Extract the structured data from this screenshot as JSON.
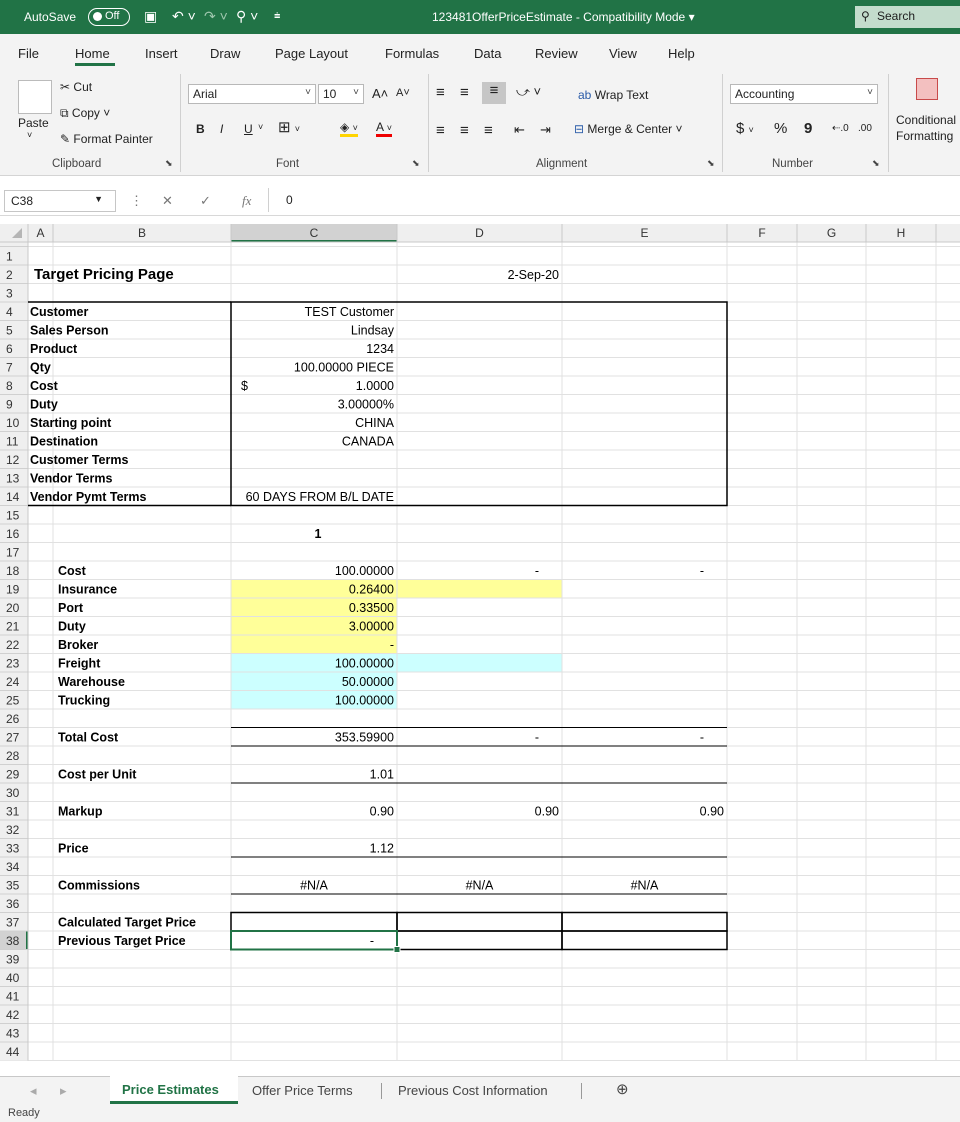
{
  "titlebar": {
    "autosave_label": "AutoSave",
    "autosave_state": "Off",
    "doc_title": "123481OfferPriceEstimate  -  Compatibility Mode",
    "search_label": "Search"
  },
  "menu": [
    "File",
    "Home",
    "Insert",
    "Draw",
    "Page Layout",
    "Formulas",
    "Data",
    "Review",
    "View",
    "Help"
  ],
  "ribbon": {
    "paste": "Paste",
    "cut": "Cut",
    "copy": "Copy",
    "format_painter": "Format Painter",
    "clipboard_group": "Clipboard",
    "font_name": "Arial",
    "font_size": "10",
    "bold": "B",
    "italic": "I",
    "underline": "U",
    "font_group": "Font",
    "wrap_text": "Wrap Text",
    "merge_center": "Merge & Center",
    "alignment_group": "Alignment",
    "number_format": "Accounting",
    "currency": "$",
    "percent": "%",
    "comma": "9",
    "number_group": "Number",
    "conditional_formatting": "Conditional Formatting"
  },
  "formula_bar": {
    "name_box": "C38",
    "fx": "fx",
    "value": "0"
  },
  "columns": [
    "A",
    "B",
    "C",
    "D",
    "E",
    "F",
    "G",
    "H"
  ],
  "rows": [
    "1",
    "2",
    "3",
    "4",
    "5",
    "6",
    "7",
    "8",
    "9",
    "10",
    "11",
    "12",
    "13",
    "14",
    "15",
    "16",
    "17",
    "18",
    "19",
    "20",
    "21",
    "22",
    "23",
    "24",
    "25",
    "26",
    "27",
    "28",
    "29",
    "30",
    "31",
    "32",
    "33",
    "34",
    "35",
    "36",
    "37",
    "38",
    "39",
    "40",
    "41",
    "42",
    "43",
    "44"
  ],
  "cells": {
    "title": "Target Pricing Page",
    "date": "2-Sep-20",
    "info": [
      {
        "label": "Customer",
        "value": "TEST Customer"
      },
      {
        "label": "Sales Person",
        "value": "Lindsay"
      },
      {
        "label": "Product",
        "value": "1234"
      },
      {
        "label": "Qty",
        "value": "100.00000 PIECE"
      },
      {
        "label": "Cost",
        "value": "1.0000",
        "prefix": "$"
      },
      {
        "label": "Duty",
        "value": "3.00000%"
      },
      {
        "label": "Starting point",
        "value": "CHINA"
      },
      {
        "label": "Destination",
        "value": "CANADA"
      },
      {
        "label": "Customer Terms",
        "value": ""
      },
      {
        "label": "Vendor Terms",
        "value": ""
      },
      {
        "label": "Vendor Pymt Terms",
        "value": "60 DAYS FROM B/L DATE"
      }
    ],
    "column_header": "1",
    "costs": [
      {
        "label": "Cost",
        "c": "100.00000",
        "d": "-",
        "e": "-"
      },
      {
        "label": "Insurance",
        "c": "0.26400",
        "d": "",
        "e": ""
      },
      {
        "label": "Port",
        "c": "0.33500",
        "d": "",
        "e": ""
      },
      {
        "label": "Duty",
        "c": "3.00000",
        "d": "",
        "e": ""
      },
      {
        "label": "Broker",
        "c": "-",
        "d": "",
        "e": ""
      },
      {
        "label": "Freight",
        "c": "100.00000",
        "d": "",
        "e": ""
      },
      {
        "label": "Warehouse",
        "c": "50.00000",
        "d": "",
        "e": ""
      },
      {
        "label": "Trucking",
        "c": "100.00000",
        "d": "",
        "e": ""
      }
    ],
    "total_cost": {
      "label": "Total Cost",
      "c": "353.59900",
      "d": "-",
      "e": "-"
    },
    "cost_per_unit": {
      "label": "Cost per Unit",
      "c": "1.01"
    },
    "markup": {
      "label": "Markup",
      "c": "0.90",
      "d": "0.90",
      "e": "0.90"
    },
    "price": {
      "label": "Price",
      "c": "1.12"
    },
    "commissions": {
      "label": "Commissions",
      "c": "#N/A",
      "d": "#N/A",
      "e": "#N/A"
    },
    "calc_target": {
      "label": "Calculated Target Price"
    },
    "prev_target": {
      "label": "Previous Target Price",
      "c": "-"
    }
  },
  "sheets": {
    "active": "Price Estimates",
    "others": [
      "Offer Price Terms",
      "Previous Cost Information"
    ]
  },
  "status": "Ready",
  "colors": {
    "excel_green": "#217346",
    "yellow_fill": "#ffff99",
    "cyan_fill": "#ccffff",
    "selection": "#217346"
  }
}
